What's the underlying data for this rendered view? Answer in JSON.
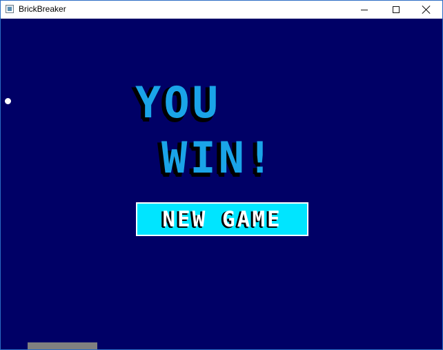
{
  "window": {
    "title": "BrickBreaker",
    "controls": [
      "minimize",
      "maximize",
      "close"
    ]
  },
  "game": {
    "message_line1": "YOU",
    "message_line2": "WIN!",
    "new_game_label": "NEW GAME"
  },
  "colors": {
    "background": "#000066",
    "title_text": "#1aa4e8",
    "button_bg": "#00e5ff",
    "paddle": "#808080",
    "ball": "#ffffff"
  },
  "icons": {
    "app": "brickbreaker-app-icon",
    "minimize": "minimize-icon",
    "maximize": "maximize-icon",
    "close": "close-icon"
  }
}
